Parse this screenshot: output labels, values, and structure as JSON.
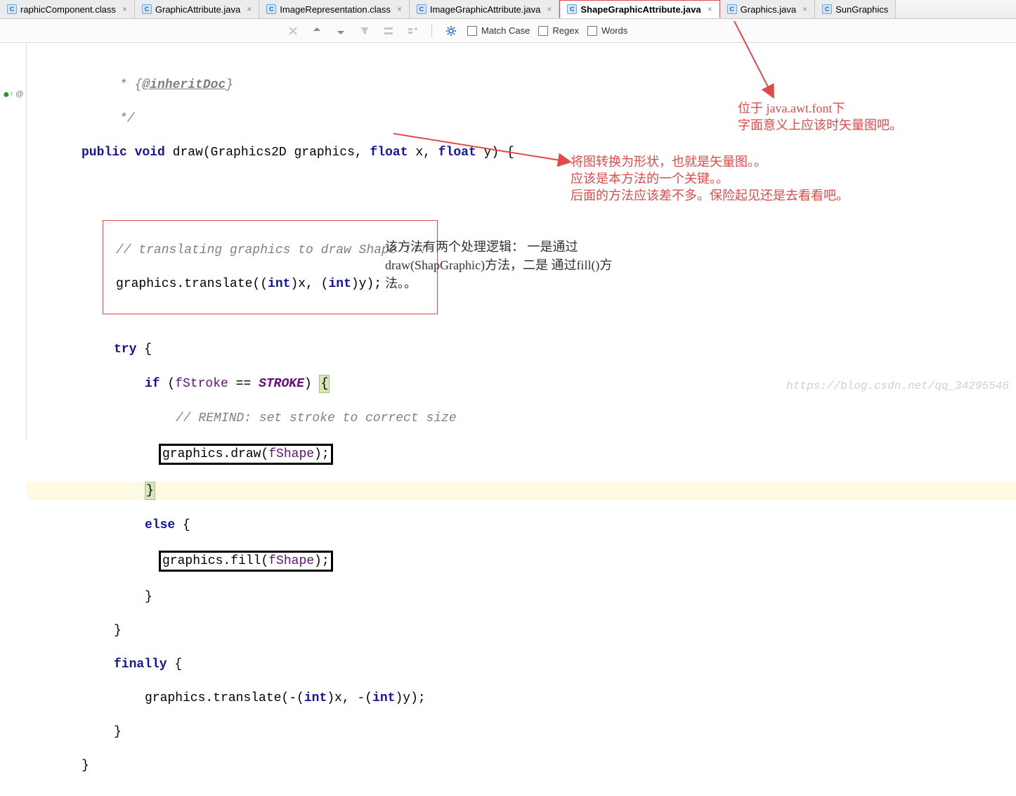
{
  "tabs": [
    {
      "label": "raphicComponent.class"
    },
    {
      "label": "GraphicAttribute.java"
    },
    {
      "label": "ImageRepresentation.class"
    },
    {
      "label": "ImageGraphicAttribute.java"
    },
    {
      "label": "ShapeGraphicAttribute.java",
      "active": true
    },
    {
      "label": "Graphics.java"
    },
    {
      "label": "SunGraphics"
    }
  ],
  "toolbar": {
    "match_case": "Match Case",
    "regex": "Regex",
    "words": "Words"
  },
  "code": {
    "doc1": "     * {",
    "doc_tag": "@inheritDoc",
    "doc1b": "}",
    "doc2": "     */",
    "sig_public": "public",
    "sig_void": "void",
    "sig_name": " draw(Graphics2D graphics, ",
    "sig_float1": "float",
    "sig_x": " x, ",
    "sig_float2": "float",
    "sig_y": " y) {",
    "cm1": "// translating graphics to draw Shape !!!",
    "t1": "graphics.translate((",
    "t1_int1": "int",
    "t1_b": ")x, (",
    "t1_int2": "int",
    "t1_c": ")y);",
    "try_kw": "try",
    "try_b": " {",
    "if_kw": "if",
    "if_a": " (",
    "if_field": "fStroke",
    "if_eq": " == ",
    "if_const": "STROKE",
    "if_b": ") ",
    "cm2": "// REMIND: set stroke to correct size",
    "draw_a": "graphics.draw(",
    "draw_f": "fShape",
    "draw_b": ");",
    "brace_close1": "}",
    "else_kw": "else",
    "else_b": " {",
    "fill_a": "graphics.fill(",
    "fill_f": "fShape",
    "fill_b": ");",
    "brace_close2": "}",
    "brace_close3": "}",
    "finally_kw": "finally",
    "finally_b": " {",
    "t2": "graphics.translate(-(",
    "t2_int1": "int",
    "t2_b": ")x, -(",
    "t2_int2": "int",
    "t2_c": ")y);",
    "brace_close4": "}",
    "brace_close5": "}"
  },
  "anno_top": {
    "l1": "位于 java.awt.font下",
    "l2": "字面意义上应该时矢量图吧。"
  },
  "anno_mid": {
    "l1": "将图转换为形状，也就是矢量图。。",
    "l2": "应该是本方法的一个关键。。",
    "l3": "后面的方法应该差不多。保险起见还是去看看吧。"
  },
  "anno_black": {
    "l1": "该方法有两个处理逻辑：  一是通过",
    "l2": "draw(ShapGraphic)方法，二是 通过fill()方",
    "l3": "法。。"
  },
  "watermark": "https://blog.csdn.net/qq_34295546",
  "gutter_mark": "@"
}
